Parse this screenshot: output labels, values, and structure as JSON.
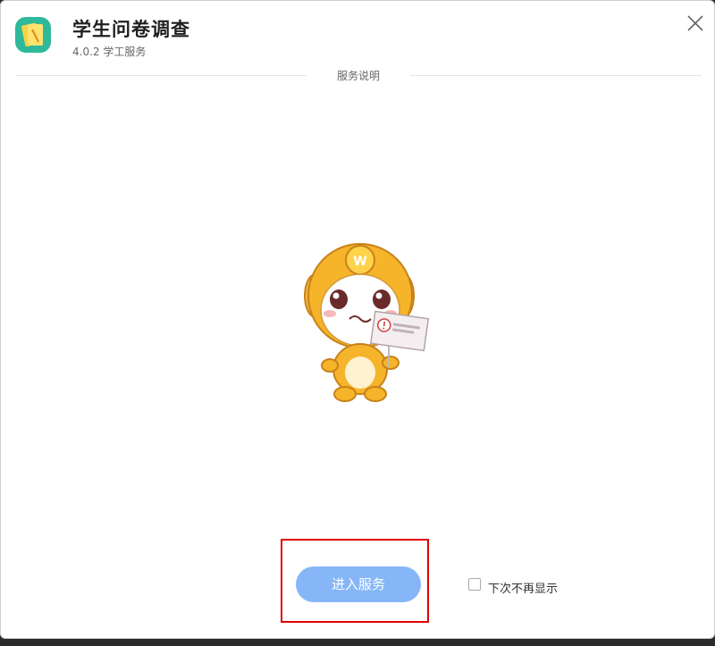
{
  "app": {
    "title": "学生问卷调查",
    "subtitle": "4.0.2 学工服务",
    "icon": "notebook-icon"
  },
  "section": {
    "divider_label": "服务说明"
  },
  "footer": {
    "enter_button": "进入服务",
    "dont_show_again": "下次不再显示",
    "dont_show_again_checked": false
  },
  "colors": {
    "primary_button": "#86b6f7",
    "icon_bg": "#2fb99a",
    "highlight": "#e00000"
  }
}
